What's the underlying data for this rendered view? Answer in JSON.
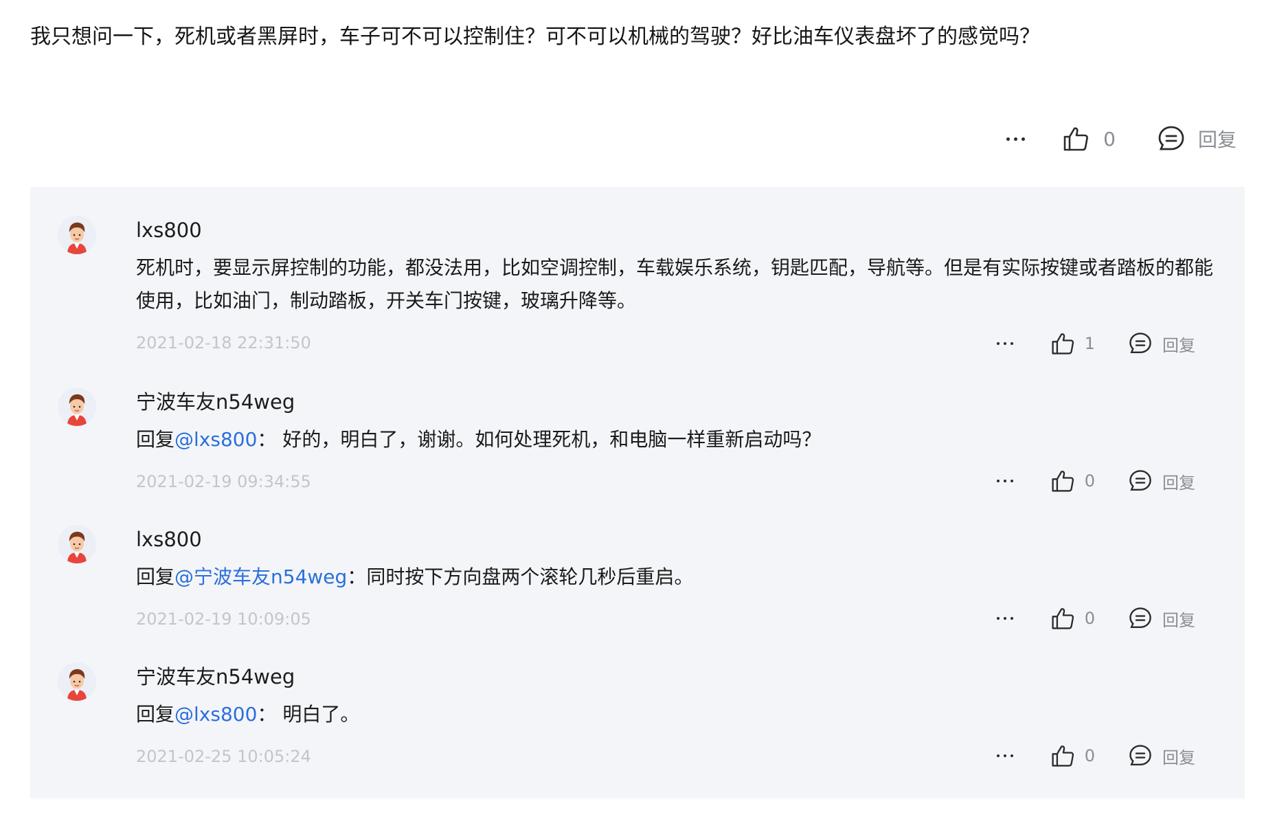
{
  "question": {
    "text": "我只想问一下，死机或者黑屏时，车子可不可以控制住？可不可以机械的驾驶？好比油车仪表盘坏了的感觉吗？"
  },
  "main_actions": {
    "like_count": "0",
    "reply_label": "回复"
  },
  "comments": [
    {
      "username": "lxs800",
      "reply_prefix": "",
      "mention": "",
      "separator": "",
      "text": "死机时，要显示屏控制的功能，都没法用，比如空调控制，车载娱乐系统，钥匙匹配，导航等。但是有实际按键或者踏板的都能使用，比如油门，制动踏板，开关车门按键，玻璃升降等。",
      "timestamp": "2021-02-18 22:31:50",
      "like_count": "1",
      "reply_label": "回复"
    },
    {
      "username": "宁波车友n54weg",
      "reply_prefix": "回复",
      "mention": "@lxs800",
      "separator": "：",
      "text": " 好的，明白了，谢谢。如何处理死机，和电脑一样重新启动吗？",
      "timestamp": "2021-02-19 09:34:55",
      "like_count": "0",
      "reply_label": "回复"
    },
    {
      "username": "lxs800",
      "reply_prefix": "回复",
      "mention": "@宁波车友n54weg",
      "separator": "：",
      "text": "同时按下方向盘两个滚轮几秒后重启。",
      "timestamp": "2021-02-19 10:09:05",
      "like_count": "0",
      "reply_label": "回复"
    },
    {
      "username": "宁波车友n54weg",
      "reply_prefix": "回复",
      "mention": "@lxs800",
      "separator": "：",
      "text": " 明白了。",
      "timestamp": "2021-02-25 10:05:24",
      "like_count": "0",
      "reply_label": "回复"
    }
  ],
  "icons": {
    "more": "more-dots-icon",
    "like": "thumbs-up-icon",
    "reply": "comment-bubble-icon",
    "avatar": "user-avatar"
  },
  "colors": {
    "mention": "#2a6fdb",
    "timestamp": "#c2c5cb",
    "panel_bg": "#f4f5f8",
    "muted": "#8a8d94"
  }
}
